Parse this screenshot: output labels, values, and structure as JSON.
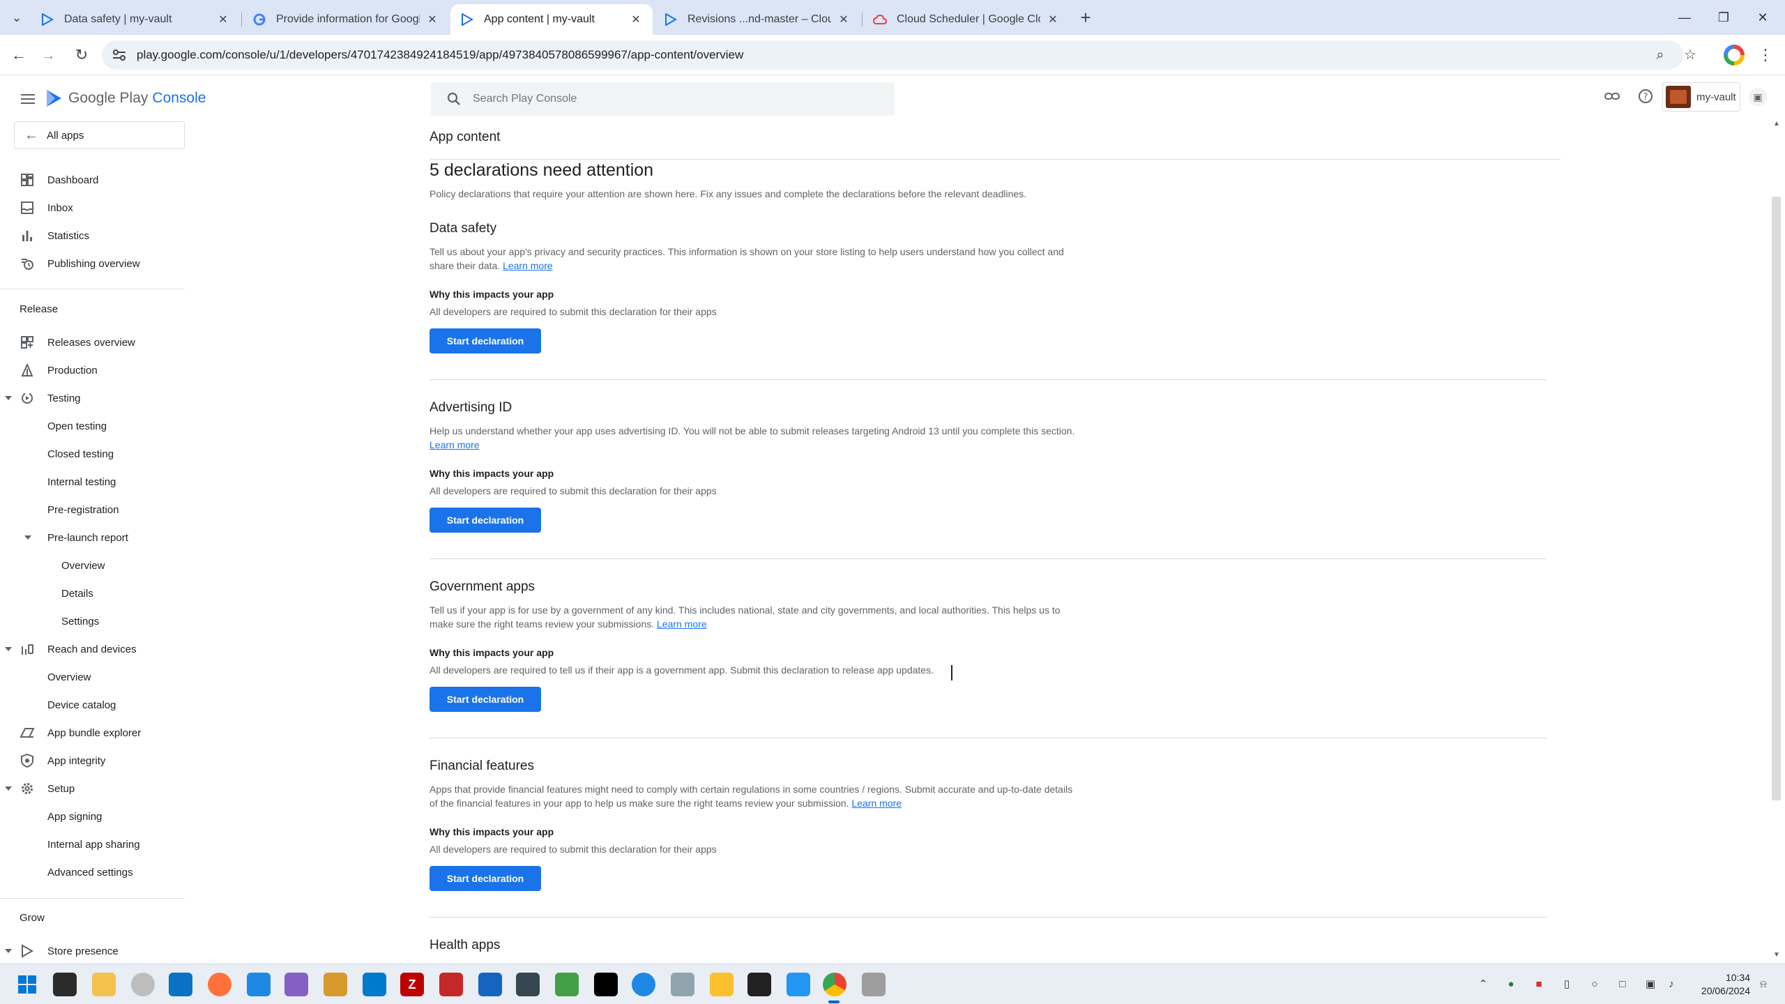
{
  "browser": {
    "tabs": [
      {
        "title": "Data safety | my-vault"
      },
      {
        "title": "Provide information for Google"
      },
      {
        "title": "App content | my-vault"
      },
      {
        "title": "Revisions ...nd-master – Cloud"
      },
      {
        "title": "Cloud Scheduler | Google Clo"
      }
    ],
    "url": "play.google.com/console/u/1/developers/4701742384924184519/app/4973840578086599967/app-content/overview"
  },
  "header": {
    "logo_google_play": "Google Play",
    "logo_console": "Console",
    "search_placeholder": "Search Play Console",
    "account_name": "my-vault"
  },
  "sidebar": {
    "all_apps": "All apps",
    "top": [
      {
        "label": "Dashboard",
        "icon": "dashboard-icon"
      },
      {
        "label": "Inbox",
        "icon": "inbox-icon"
      },
      {
        "label": "Statistics",
        "icon": "statistics-icon"
      },
      {
        "label": "Publishing overview",
        "icon": "publishing-icon"
      }
    ],
    "release_header": "Release",
    "release": {
      "releases_overview": "Releases overview",
      "production": "Production",
      "testing": "Testing",
      "open_testing": "Open testing",
      "closed_testing": "Closed testing",
      "internal_testing": "Internal testing",
      "pre_registration": "Pre-registration",
      "pre_launch_report": "Pre-launch report",
      "pl_overview": "Overview",
      "pl_details": "Details",
      "pl_settings": "Settings",
      "reach_and_devices": "Reach and devices",
      "rd_overview": "Overview",
      "device_catalog": "Device catalog",
      "app_bundle_explorer": "App bundle explorer",
      "app_integrity": "App integrity",
      "setup": "Setup",
      "app_signing": "App signing",
      "internal_app_sharing": "Internal app sharing",
      "advanced_settings": "Advanced settings"
    },
    "grow_header": "Grow",
    "store_presence": "Store presence"
  },
  "main": {
    "page_title": "App content",
    "headline": "5 declarations need attention",
    "subline": "Policy declarations that require your attention are shown here. Fix any issues and complete the declarations before the relevant deadlines.",
    "why_label": "Why this impacts your app",
    "learn_more": "Learn more",
    "start_label": "Start declaration",
    "declarations": [
      {
        "title": "Data safety",
        "desc": "Tell us about your app's privacy and security practices. This information is shown on your store listing to help users understand how you collect and share their data.",
        "why": "All developers are required to submit this declaration for their apps"
      },
      {
        "title": "Advertising ID",
        "desc": "Help us understand whether your app uses advertising ID. You will not be able to submit releases targeting Android 13 until you complete this section.",
        "why": "All developers are required to submit this declaration for their apps"
      },
      {
        "title": "Government apps",
        "desc": "Tell us if your app is for use by a government of any kind. This includes national, state and city governments, and local authorities. This helps us to make sure the right teams review your submissions.",
        "why": "All developers are required to tell us if their app is a government app. Submit this declaration to release app updates."
      },
      {
        "title": "Financial features",
        "desc": "Apps that provide financial features might need to comply with certain regulations in some countries / regions. Submit accurate and up-to-date details of the financial features in your app to help us make sure the right teams review your submission.",
        "why": "All developers are required to submit this declaration for their apps"
      }
    ],
    "next_title": "Health apps"
  },
  "taskbar": {
    "time": "10:34",
    "date": "20/06/2024"
  },
  "colors": {
    "primary": "#1a73e8",
    "text": "#202124",
    "muted": "#5f6368",
    "chrome_bg": "#dbe5f6"
  }
}
